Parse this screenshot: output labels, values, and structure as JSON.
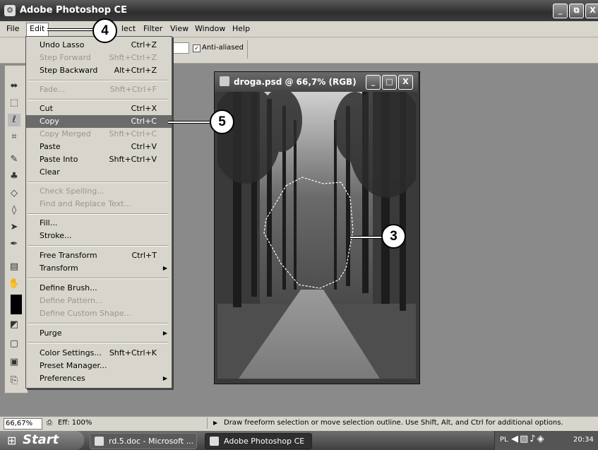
{
  "window": {
    "title": "Adobe Photoshop CE",
    "buttons": {
      "minimize": "_",
      "restore": "⧉",
      "close": "X"
    }
  },
  "menubar": {
    "items": [
      "File",
      "Edit",
      "lect",
      "Filter",
      "View",
      "Window",
      "Help"
    ]
  },
  "options": {
    "antialias_checked": "✓",
    "antialias_label": "Anti-aliased"
  },
  "edit_menu": {
    "items": [
      {
        "label": "Undo Lasso",
        "shortcut": "Ctrl+Z"
      },
      {
        "label": "Step Forward",
        "shortcut": "Shft+Ctrl+Z"
      },
      {
        "label": "Step Backward",
        "shortcut": "Alt+Ctrl+Z"
      },
      {
        "label": "Fade...",
        "shortcut": "Shft+Ctrl+F"
      },
      {
        "label": "Cut",
        "shortcut": "Ctrl+X"
      },
      {
        "label": "Copy",
        "shortcut": "Ctrl+C"
      },
      {
        "label": "Copy Merged",
        "shortcut": "Shft+Ctrl+C"
      },
      {
        "label": "Paste",
        "shortcut": "Ctrl+V"
      },
      {
        "label": "Paste Into",
        "shortcut": "Shft+Ctrl+V"
      },
      {
        "label": "Clear",
        "shortcut": ""
      },
      {
        "label": "Check Spelling...",
        "shortcut": ""
      },
      {
        "label": "Find and Replace Text...",
        "shortcut": ""
      },
      {
        "label": "Fill...",
        "shortcut": ""
      },
      {
        "label": "Stroke...",
        "shortcut": ""
      },
      {
        "label": "Free Transform",
        "shortcut": "Ctrl+T"
      },
      {
        "label": "Transform",
        "shortcut": ""
      },
      {
        "label": "Define Brush...",
        "shortcut": ""
      },
      {
        "label": "Define Pattern...",
        "shortcut": ""
      },
      {
        "label": "Define Custom Shape...",
        "shortcut": ""
      },
      {
        "label": "Purge",
        "shortcut": ""
      },
      {
        "label": "Color Settings...",
        "shortcut": "Shft+Ctrl+K"
      },
      {
        "label": "Preset Manager...",
        "shortcut": ""
      },
      {
        "label": "Preferences",
        "shortcut": ""
      }
    ],
    "submenu_arrow": "▶"
  },
  "document": {
    "title": "droga.psd @ 66,7% (RGB)",
    "buttons": {
      "minimize": "_",
      "maximize": "□",
      "close": "X"
    }
  },
  "statusbar": {
    "zoom": "66,67%",
    "doc_info": "Eff: 100%",
    "arrow": "▶",
    "message": "Draw freeform selection or move selection outline. Use Shift, Alt, and Ctrl for additional options."
  },
  "taskbar": {
    "start_label": "Start",
    "tasks": [
      "rd.5.doc - Microsoft ...",
      "Adobe Photoshop CE"
    ],
    "tray_lang": "PL",
    "clock": "20:34"
  },
  "callouts": {
    "c3": "3",
    "c4": "4",
    "c5": "5"
  }
}
